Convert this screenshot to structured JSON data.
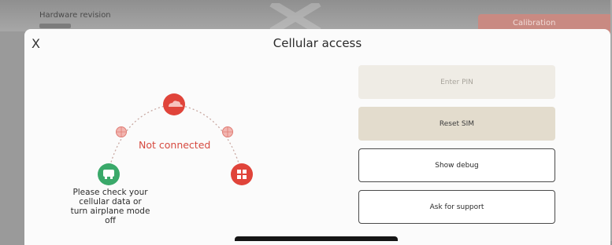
{
  "background": {
    "label": "Hardware revision",
    "button_label": "Calibration"
  },
  "modal": {
    "close_label": "X",
    "title": "Cellular access",
    "status_text": "Not connected",
    "help_lines": [
      "Please check your",
      "cellular data or",
      "turn airplane mode",
      "off"
    ],
    "buttons": {
      "enter_pin": "Enter PIN",
      "reset_sim": "Reset SIM",
      "show_debug": "Show debug",
      "ask_support": "Ask for support"
    }
  },
  "colors": {
    "error_red": "#e0443a",
    "ok_green": "#3aa96a",
    "disabled_button": "#efece5",
    "primary_button": "#e3dccd"
  },
  "icons": {
    "cloud_node": "cloud-icon",
    "device_node": "device-icon",
    "sim_node": "sim-icon",
    "globe": "globe-icon"
  }
}
